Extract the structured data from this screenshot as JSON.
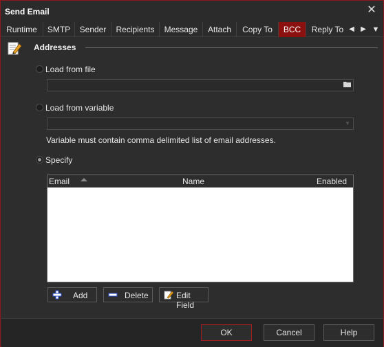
{
  "window": {
    "title": "Send Email"
  },
  "tabs": [
    {
      "label": "Runtime",
      "active": false
    },
    {
      "label": "SMTP",
      "active": false
    },
    {
      "label": "Sender",
      "active": false
    },
    {
      "label": "Recipients",
      "active": false
    },
    {
      "label": "Message",
      "active": false
    },
    {
      "label": "Attach",
      "active": false
    },
    {
      "label": "Copy To",
      "active": false
    },
    {
      "label": "BCC",
      "active": true
    },
    {
      "label": "Reply To",
      "active": false
    }
  ],
  "section": {
    "title": "Addresses"
  },
  "options": {
    "load_from_file": {
      "label": "Load from file",
      "checked": false,
      "value": ""
    },
    "load_from_variable": {
      "label": "Load from variable",
      "checked": false,
      "value": ""
    },
    "hint": "Variable must contain comma delimited list of email addresses.",
    "specify": {
      "label": "Specify",
      "checked": true
    }
  },
  "grid": {
    "columns": [
      "Email",
      "Name",
      "Enabled"
    ],
    "sort_column": "Email",
    "rows": []
  },
  "actions": {
    "add": "Add",
    "delete": "Delete",
    "edit_field": "Edit Field"
  },
  "footer": {
    "ok": "OK",
    "cancel": "Cancel",
    "help": "Help"
  },
  "colors": {
    "accent": "#8b1010",
    "background": "#2d2d2d"
  }
}
